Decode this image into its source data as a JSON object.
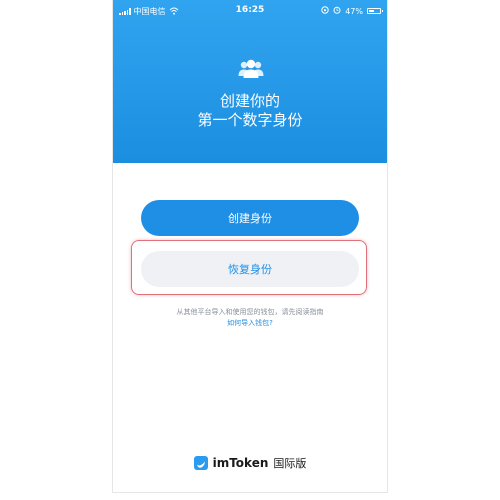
{
  "status_bar": {
    "carrier": "中国电信",
    "time": "16:25",
    "battery": "47%",
    "battery_level": 0.47
  },
  "hero": {
    "title_line1": "创建你的",
    "title_line2": "第一个数字身份"
  },
  "actions": {
    "create_label": "创建身份",
    "restore_label": "恢复身份"
  },
  "note": {
    "text": "从其他平台导入和使用您的钱包，请先阅读指南",
    "link": "如何导入钱包?"
  },
  "brand": {
    "name": "imToken",
    "suffix": "国际版"
  },
  "colors": {
    "primary": "#1f8fe6",
    "highlight": "#e0707a"
  },
  "icons": [
    "signal-icon",
    "wifi-icon",
    "lock-rotation-icon",
    "alarm-icon",
    "battery-icon",
    "users-icon",
    "imtoken-logo-icon"
  ]
}
